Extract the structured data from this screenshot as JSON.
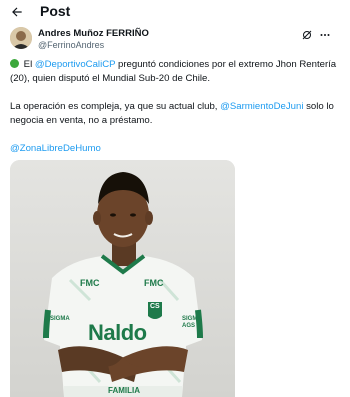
{
  "header": {
    "title": "Post"
  },
  "author": {
    "name": "Andres Muñoz FERRIÑO",
    "handle": "@FerrinoAndres"
  },
  "tweet": {
    "p1_prefix": "El ",
    "p1_mention": "@DeportivoCaliCP",
    "p1_rest": " preguntó condiciones por el extremo Jhon Rentería (20), quien disputó el Mundial Sub-20 de Chile.",
    "p2_prefix": "La operación es compleja, ya que su actual club, ",
    "p2_mention": "@SarmientoDeJuni",
    "p2_rest": " solo lo negocia en venta, no a préstamo.",
    "p3_mention": "@ZonaLibreDeHumo"
  },
  "jersey": {
    "sponsor_left": "FMC",
    "sponsor_right": "FMC",
    "crest": "CS",
    "sleeve_left": "SIGMA",
    "sleeve_right": "SIGMA AGS",
    "chest": "Naldo",
    "bottom": "FAMILIA"
  },
  "colors": {
    "accent": "#1d9bf0",
    "jersey_green": "#1e7a4a",
    "status_dot": "#3ca83c"
  }
}
